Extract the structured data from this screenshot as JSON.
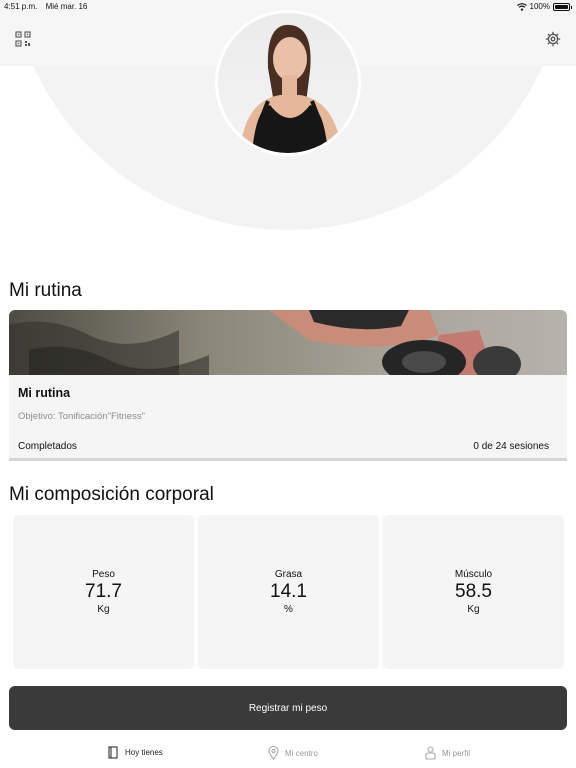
{
  "status_bar": {
    "time": "4:51 p.m.",
    "date": "Mié mar. 16",
    "battery": "100%",
    "battery_level": 1.0
  },
  "header": {
    "qr_icon": "qr-code-icon",
    "settings_icon": "gear-icon"
  },
  "routine": {
    "section_title": "Mi rutina",
    "card_title": "Mi rutina",
    "goal": "Objetivo: Tonificación\"Fitness\"",
    "completed_label": "Completados",
    "progress": "0 de 24 sesiones"
  },
  "composition": {
    "section_title": "Mi composición corporal",
    "metrics": [
      {
        "label": "Peso",
        "value": "71.7",
        "unit": "Kg"
      },
      {
        "label": "Grasa",
        "value": "14.1",
        "unit": "%"
      },
      {
        "label": "Músculo",
        "value": "58.5",
        "unit": "Kg"
      }
    ]
  },
  "actions": {
    "register_weight": "Registrar mi peso"
  },
  "tabs": [
    {
      "label": "Hoy tienes",
      "icon": "book-icon",
      "active": true
    },
    {
      "label": "Mi centro",
      "icon": "location-pin-icon",
      "active": false
    },
    {
      "label": "Mi perfil",
      "icon": "person-icon",
      "active": false
    }
  ]
}
